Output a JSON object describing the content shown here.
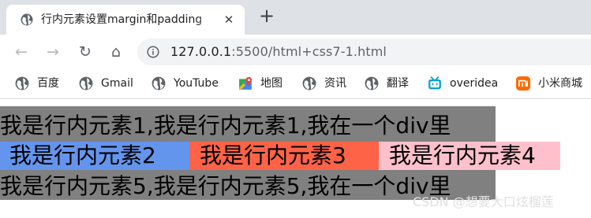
{
  "browser": {
    "tab": {
      "title": "行内元素设置margin和padding",
      "favicon": "globe-icon",
      "close_glyph": "✕"
    },
    "new_tab_glyph": "+",
    "toolbar": {
      "back_glyph": "←",
      "forward_glyph": "→",
      "reload_glyph": "↻",
      "home_glyph": "⌂"
    },
    "address": {
      "host": "127.0.0.1",
      "rest": ":5500/html+css7-1.html",
      "icon": "info-icon"
    },
    "bookmarks": [
      {
        "label": "百度",
        "icon": "globe-icon"
      },
      {
        "label": "Gmail",
        "icon": "globe-icon"
      },
      {
        "label": "YouTube",
        "icon": "globe-icon"
      },
      {
        "label": "地图",
        "icon": "maps-icon"
      },
      {
        "label": "资讯",
        "icon": "globe-icon"
      },
      {
        "label": "翻译",
        "icon": "globe-icon"
      },
      {
        "label": "overidea",
        "icon": "bilibili-icon"
      },
      {
        "label": "小米商城",
        "icon": "mi-icon"
      }
    ]
  },
  "page": {
    "line1": "我是行内元素1,我是行内元素1,我在一个div里",
    "spans": [
      {
        "text": "我是行内元素2",
        "color": "#6495ed"
      },
      {
        "text": "我是行内元素3",
        "color": "#ff6347"
      },
      {
        "text": "我是行内元素4",
        "color": "#ffc0cb"
      }
    ],
    "line5": "我是行内元素5,我是行内元素5,我在一个div里",
    "div_background": "#808080"
  },
  "watermark": "CSDN @想要大口炫榴莲"
}
